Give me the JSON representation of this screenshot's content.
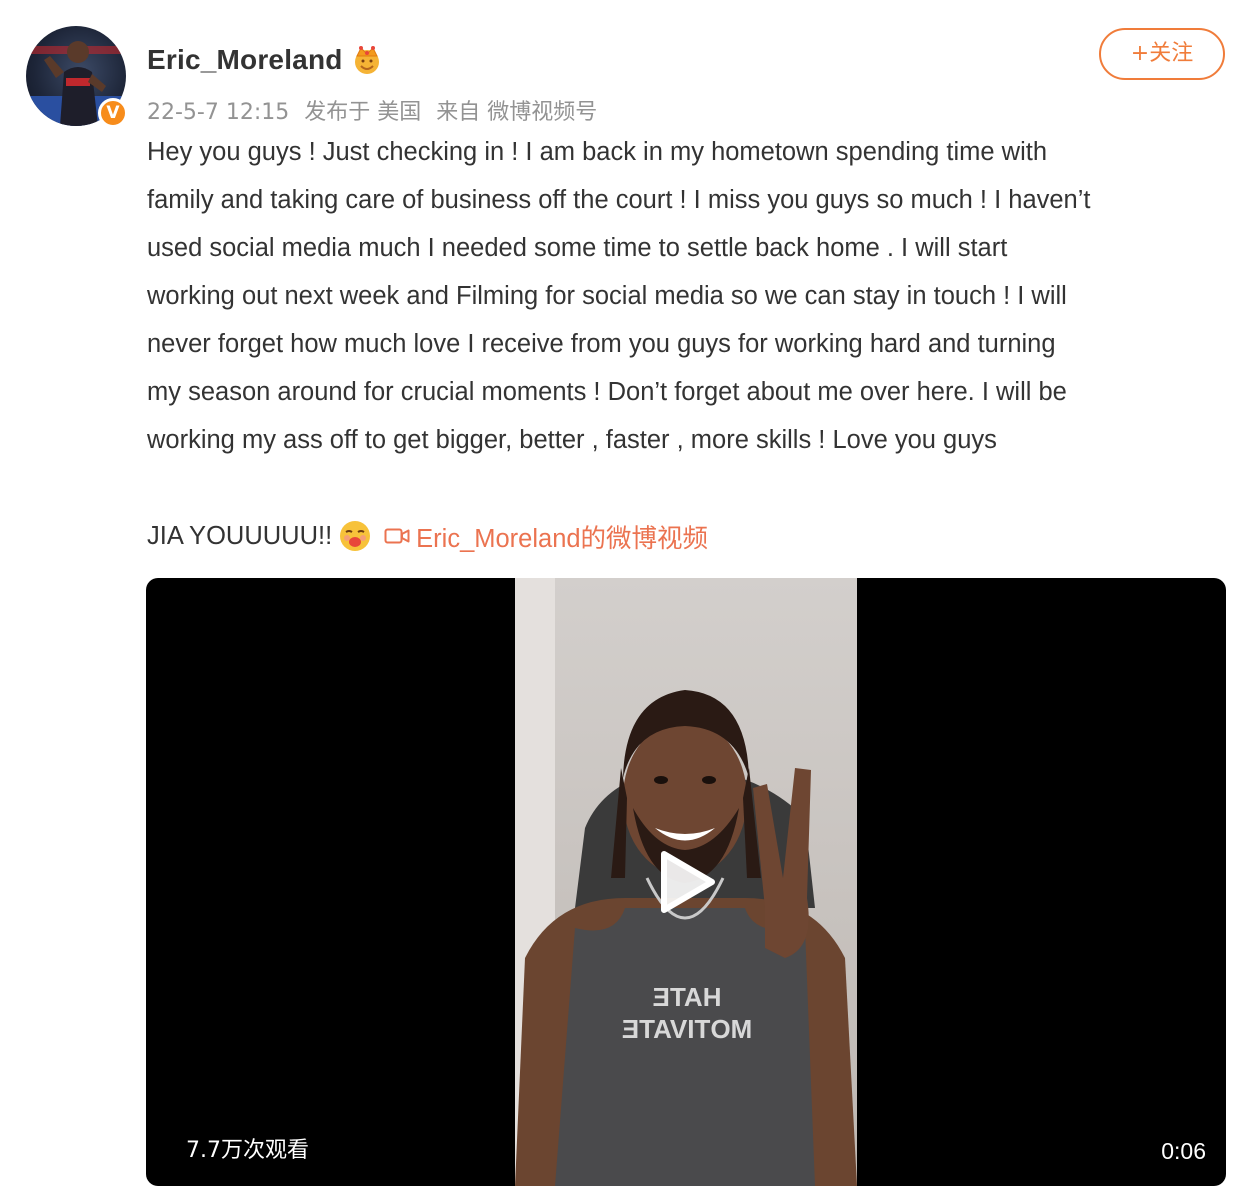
{
  "post": {
    "username": "Eric_Moreland",
    "verified_badge": "V",
    "meta": {
      "timestamp": "22-5-7 12:15",
      "location": "发布于 美国",
      "source": "来自 微博视频号"
    },
    "follow_label": "+关注",
    "body": "Hey you guys ! Just checking in ! I am back in my hometown spending time with\nfamily and taking care of business off the court ! I miss you guys so much ! I haven’t\nused social media much I needed some time to settle back home . I will start\nworking out next week and Filming for social media so we can stay in touch ! I will\nnever forget how much love I receive from you guys for working hard and turning\nmy season around for crucial moments ! Don’t forget about me over here. I will be\nworking my ass off to get bigger, better , faster , more skills ! Love you guys",
    "tail_text": "JIA YOUUUUU!!",
    "video_link_label": "Eric_Moreland的微博视频",
    "tank_top_text": "USE HATE TO MOTIVATE",
    "icons": {
      "crown": "crown-icon",
      "emoji": "kiss-face-emoji-icon",
      "video_link": "video-camera-icon",
      "play": "play-icon"
    },
    "colors": {
      "accent": "#eb7350",
      "follow": "#f07c3a",
      "meta_text": "#939393",
      "badge": "#f78c1b"
    }
  },
  "video": {
    "views": "7.7万次观看",
    "duration": "0:06"
  }
}
